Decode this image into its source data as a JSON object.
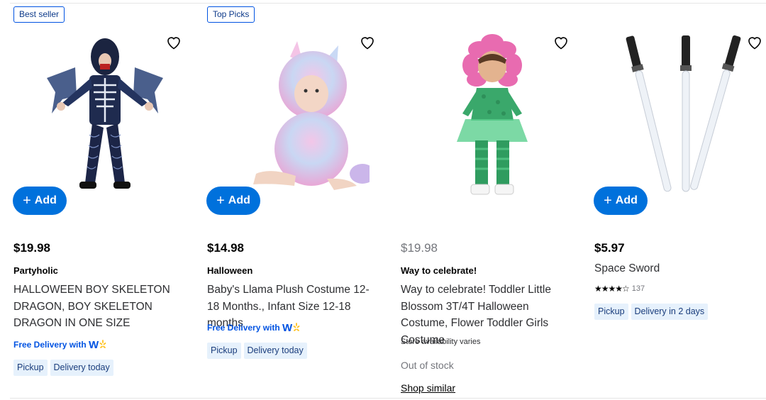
{
  "products": [
    {
      "badge": "Best seller",
      "price": "$19.98",
      "brand": "Partyholic",
      "title": "HALLOWEEN BOY SKELETON DRAGON, BOY SKELETON DRAGON IN ONE SIZE",
      "free_delivery": "Free Delivery with",
      "chips": [
        "Pickup",
        "Delivery today"
      ],
      "add_label": "Add"
    },
    {
      "badge": "Top Picks",
      "price": "$14.98",
      "brand": "Halloween",
      "title": "Baby's Llama Plush Costume 12-18 Months., Infant Size 12-18 months",
      "free_delivery": "Free Delivery with",
      "chips": [
        "Pickup",
        "Delivery today"
      ],
      "add_label": "Add"
    },
    {
      "price": "$19.98",
      "brand": "Way to celebrate!",
      "title": "Way to celebrate! Toddler Little Blossom 3T/4T Halloween Costume, Flower Toddler Girls Costume",
      "store_note": "Store availability varies",
      "stock_status": "Out of stock",
      "shop_similar": "Shop similar"
    },
    {
      "price": "$5.97",
      "title": "Space Sword",
      "rating": 3.5,
      "review_count": "137",
      "chips": [
        "Pickup",
        "Delivery in 2 days"
      ],
      "add_label": "Add"
    }
  ],
  "colors": {
    "accent": "#0071dc",
    "chip_bg": "#e6f1fc",
    "spark": "#ffc220"
  },
  "icons": [
    "heart-outline-icon",
    "plus-icon",
    "walmart-plus-icon",
    "star-icon"
  ]
}
